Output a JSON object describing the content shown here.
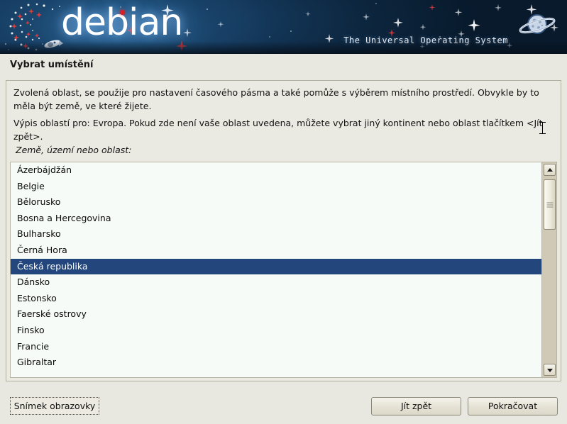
{
  "banner": {
    "wordmark": "debian",
    "tagline": "The Universal Operating System",
    "icons": {
      "swirl": "debian-swirl-logo",
      "planet": "saturn-planet-icon",
      "rocket": "rocket-icon"
    },
    "colors": {
      "background_dark": "#0b2238",
      "background_light": "#1e4e78",
      "wordmark": "#ffffff",
      "accent_red": "#d81f26"
    }
  },
  "page": {
    "title": "Vybrat umístění"
  },
  "content": {
    "paragraph1": "Zvolená oblast, se použije pro nastavení časového pásma a také pomůže s výběrem místního prostředí. Obvykle by to měla být země, ve které žijete.",
    "paragraph2": "Výpis oblastí pro: Evropa. Pokud zde není vaše oblast uvedena, můžete vybrat jiný kontinent nebo oblast tlačítkem <Jít zpět>.",
    "list_label": "Země, území nebo oblast:"
  },
  "country_list": {
    "selected": "Česká republika",
    "selection_color": "#23467c",
    "background_color": "#f7fbf7",
    "items": [
      "Ázerbájdžán",
      "Belgie",
      "Bělorusko",
      "Bosna a Hercegovina",
      "Bulharsko",
      "Černá Hora",
      "Česká republika",
      "Dánsko",
      "Estonsko",
      "Faerské ostrovy",
      "Finsko",
      "Francie",
      "Gibraltar"
    ]
  },
  "scrollbar": {
    "up_arrow": "scroll-up-arrow",
    "down_arrow": "scroll-down-arrow",
    "thumb": "scroll-thumb"
  },
  "footer": {
    "screenshot_label": "Snímek obrazovky",
    "go_back_label": "Jít zpět",
    "continue_label": "Pokračovat"
  }
}
